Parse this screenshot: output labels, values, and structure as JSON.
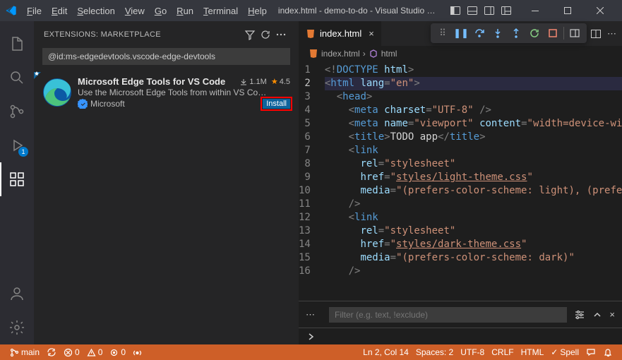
{
  "title": "index.html - demo-to-do - Visual Studio C…",
  "menus": [
    "File",
    "Edit",
    "Selection",
    "View",
    "Go",
    "Run",
    "Terminal",
    "Help"
  ],
  "activity_badge": "1",
  "sidebar": {
    "header": "EXTENSIONS: MARKETPLACE",
    "search_value": "@id:ms-edgedevtools.vscode-edge-devtools",
    "extension": {
      "name": "Microsoft Edge Tools for VS Code",
      "installs": "1.1M",
      "rating": "4.5",
      "desc": "Use the Microsoft Edge Tools from within VS Co…",
      "publisher": "Microsoft",
      "install": "Install"
    }
  },
  "tab": {
    "name": "index.html"
  },
  "breadcrumb": {
    "file": "index.html",
    "symbol": "html"
  },
  "code": {
    "lines": [
      {
        "n": 1,
        "indent": 0,
        "html": "<span class='c-pun'>&lt;!</span><span class='c-tag'>DOCTYPE</span> <span class='c-attr'>html</span><span class='c-pun'>&gt;</span>"
      },
      {
        "n": 2,
        "indent": 0,
        "cur": true,
        "html": "<span class='c-pun'>&lt;</span><span class='c-tag'>html</span> <span class='c-attr'>lang</span><span class='c-pun'>=</span><span class='c-str'>\"en\"</span><span class='c-pun'>&gt;</span>"
      },
      {
        "n": 3,
        "indent": 1,
        "html": "<span class='c-pun'>&lt;</span><span class='c-tag'>head</span><span class='c-pun'>&gt;</span>"
      },
      {
        "n": 4,
        "indent": 2,
        "html": "<span class='c-pun'>&lt;</span><span class='c-tag'>meta</span> <span class='c-attr'>charset</span><span class='c-pun'>=</span><span class='c-str'>\"UTF-8\"</span> <span class='c-pun'>/&gt;</span>"
      },
      {
        "n": 5,
        "indent": 2,
        "html": "<span class='c-pun'>&lt;</span><span class='c-tag'>meta</span> <span class='c-attr'>name</span><span class='c-pun'>=</span><span class='c-str'>\"viewport\"</span> <span class='c-attr'>content</span><span class='c-pun'>=</span><span class='c-str'>\"width=device-wid</span>"
      },
      {
        "n": 6,
        "indent": 2,
        "html": "<span class='c-pun'>&lt;</span><span class='c-tag'>title</span><span class='c-pun'>&gt;</span><span class='c-txt'>TODO app</span><span class='c-pun'>&lt;/</span><span class='c-tag'>title</span><span class='c-pun'>&gt;</span>"
      },
      {
        "n": 7,
        "indent": 2,
        "html": "<span class='c-pun'>&lt;</span><span class='c-tag'>link</span>"
      },
      {
        "n": 8,
        "indent": 3,
        "html": "<span class='c-attr'>rel</span><span class='c-pun'>=</span><span class='c-str'>\"stylesheet\"</span>"
      },
      {
        "n": 9,
        "indent": 3,
        "html": "<span class='c-attr'>href</span><span class='c-pun'>=</span><span class='c-str'>\"</span><span class='c-link'>styles/light-theme.css</span><span class='c-str'>\"</span>"
      },
      {
        "n": 10,
        "indent": 3,
        "html": "<span class='c-attr'>media</span><span class='c-pun'>=</span><span class='c-str'>\"(prefers-color-scheme: light), (prefer</span>"
      },
      {
        "n": 11,
        "indent": 2,
        "html": "<span class='c-pun'>/&gt;</span>"
      },
      {
        "n": 12,
        "indent": 2,
        "html": "<span class='c-pun'>&lt;</span><span class='c-tag'>link</span>"
      },
      {
        "n": 13,
        "indent": 3,
        "html": "<span class='c-attr'>rel</span><span class='c-pun'>=</span><span class='c-str'>\"stylesheet\"</span>"
      },
      {
        "n": 14,
        "indent": 3,
        "html": "<span class='c-attr'>href</span><span class='c-pun'>=</span><span class='c-str'>\"</span><span class='c-link'>styles/dark-theme.css</span><span class='c-str'>\"</span>"
      },
      {
        "n": 15,
        "indent": 3,
        "html": "<span class='c-attr'>media</span><span class='c-pun'>=</span><span class='c-str'>\"(prefers-color-scheme: dark)\"</span>"
      },
      {
        "n": 16,
        "indent": 2,
        "html": "<span class='c-pun'>/&gt;</span>"
      }
    ]
  },
  "panel": {
    "filter_placeholder": "Filter (e.g. text, !exclude)"
  },
  "status": {
    "branch": "main",
    "sync": "",
    "errors": "0",
    "warnings": "0",
    "ports": "0",
    "ln_col": "Ln 2, Col 14",
    "spaces": "Spaces: 2",
    "encoding": "UTF-8",
    "eol": "CRLF",
    "lang": "HTML",
    "spell": "Spell"
  }
}
